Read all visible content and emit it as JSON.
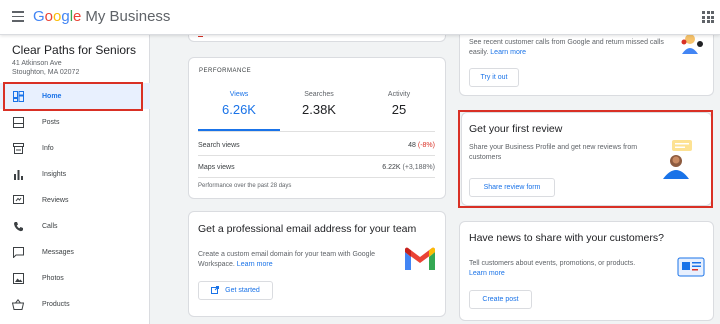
{
  "header": {
    "logo_google": "Google",
    "logo_product": "My Business",
    "menu_icon": "hamburger-menu-icon",
    "apps_icon": "apps-grid-icon"
  },
  "business": {
    "name": "Clear Paths for Seniors",
    "address_line1": "41 Atkinson Ave",
    "address_line2": "Stoughton, MA 02072"
  },
  "sidebar": {
    "items": [
      {
        "label": "Home",
        "icon": "dashboard-icon",
        "active": true
      },
      {
        "label": "Posts",
        "icon": "posts-icon"
      },
      {
        "label": "Info",
        "icon": "storefront-icon"
      },
      {
        "label": "Insights",
        "icon": "bar-chart-icon"
      },
      {
        "label": "Reviews",
        "icon": "reviews-icon"
      },
      {
        "label": "Calls",
        "icon": "phone-icon"
      },
      {
        "label": "Messages",
        "icon": "messages-icon"
      },
      {
        "label": "Photos",
        "icon": "photos-icon"
      },
      {
        "label": "Products",
        "icon": "basket-icon"
      }
    ]
  },
  "performance": {
    "label": "PERFORMANCE",
    "metrics": [
      {
        "name": "Views",
        "value": "6.26K"
      },
      {
        "name": "Searches",
        "value": "2.38K"
      },
      {
        "name": "Activity",
        "value": "25"
      }
    ],
    "rows": [
      {
        "label": "Search views",
        "value": "48",
        "change": "(-8%)"
      },
      {
        "label": "Maps views",
        "value": "6.22K",
        "change": "(+3,188%)"
      }
    ],
    "footnote": "Performance over the past 28 days"
  },
  "email_card": {
    "title": "Get a professional email address for your team",
    "text": "Create a custom email domain for your team with Google Workspace.",
    "link": "Learn more",
    "button": "Get started",
    "icon": "gmail-logo-icon"
  },
  "calls_card": {
    "text": "See recent customer calls from Google and return missed calls easily.",
    "link": "Learn more",
    "button": "Try it out"
  },
  "review_card": {
    "title": "Get your first review",
    "text": "Share your Business Profile and get new reviews from customers",
    "button": "Share review form"
  },
  "news_card": {
    "title": "Have news to share with your customers?",
    "text": "Tell customers about events, promotions, or products.",
    "link": "Learn more",
    "button": "Create post"
  },
  "colors": {
    "accent": "#1a73e8",
    "highlight": "#d93025",
    "active_bg": "#e8f0fe"
  }
}
